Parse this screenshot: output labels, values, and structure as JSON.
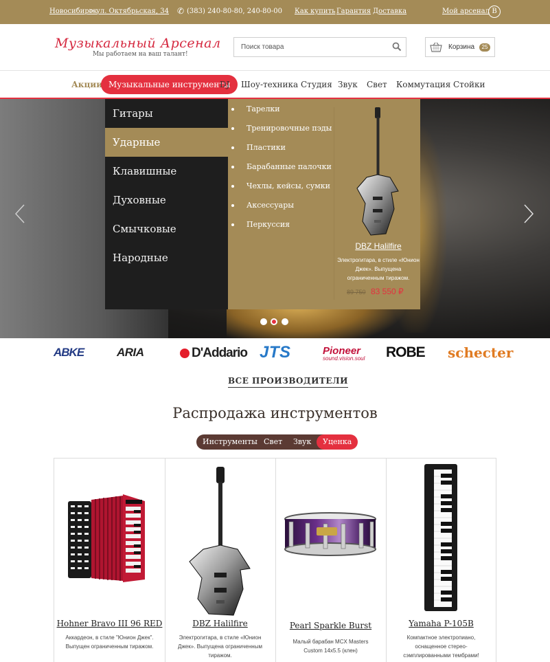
{
  "topbar": {
    "city": "Новосибирск",
    "arrow": ">",
    "address": "ул. Октябрьская, 34",
    "phone": "(383) 240-80-80, 240-80-00",
    "links": [
      "Как купить",
      "Гарантия",
      "Доставка"
    ],
    "account": "Мой арсенал",
    "login_letter": "В"
  },
  "header": {
    "logo_title": "Музыкальный Арсенал",
    "logo_subtitle": "Мы работаем на ваш талант!",
    "search_placeholder": "Поиск товара",
    "cart_label": "Корзина",
    "cart_count": "25"
  },
  "nav": {
    "items": [
      "Акции",
      "Музыкальные инструменты",
      "DJ",
      "Шоу-техника",
      "Студия",
      "Звук",
      "Свет",
      "Коммутация",
      "Стойки"
    ]
  },
  "mega_menu": {
    "categories": [
      "Гитары",
      "Ударные",
      "Клавишные",
      "Духовные",
      "Смычковые",
      "Народные"
    ],
    "selected_category": "Ударные",
    "subcategories": [
      "Тарелки",
      "Тренировочные пэды",
      "Пластики",
      "Барабанные палочки",
      "Чехлы, кейсы, сумки",
      "Аксессуары",
      "Перкуссия"
    ],
    "promo": {
      "name": "DBZ Halilfire",
      "description": "Электрогитара, в стиле «Юнион Джек». Выпущена ограниченным тиражом.",
      "old_price": "89 750",
      "new_price": "83 550 ₽"
    }
  },
  "hero": {
    "slides_total": 3,
    "active_slide": 2
  },
  "brands": {
    "items": [
      "ABKE",
      "ARIA",
      "D'Addario",
      "JTS",
      "Pioneer",
      "ROBE",
      "schecter"
    ],
    "pioneer_tagline": "sound.vision.soul",
    "all_link": "ВСЕ ПРОИЗВОДИТЕЛИ"
  },
  "sale": {
    "title": "Распродажа инструментов",
    "tabs": [
      "Инструменты",
      "Свет",
      "Звук",
      "Уценка"
    ],
    "active_tab": "Уценка",
    "products": [
      {
        "name": "Hohner Bravo III 96 RED",
        "description": "Аккардеон, в стиле \"Юнион Джек\". Выпущен ограниченным тиражом."
      },
      {
        "name": "DBZ Halilfire",
        "description": "Электрогитара, в стиле «Юнион Джек». Выпущена ограниченным тиражом."
      },
      {
        "name": "Pearl Sparkle Burst",
        "description": "Малый барабан MCX Masters Custom 14x5.5 (клен)"
      },
      {
        "name": "Yamaha P-105B",
        "description": "Компактное электропиано, оснащенное стерео-сэмплированными тембрами!"
      }
    ]
  },
  "colors": {
    "gold": "#a48b57",
    "red": "#e4303f",
    "brown": "#5b3a33",
    "dark": "#1e1e1e"
  }
}
